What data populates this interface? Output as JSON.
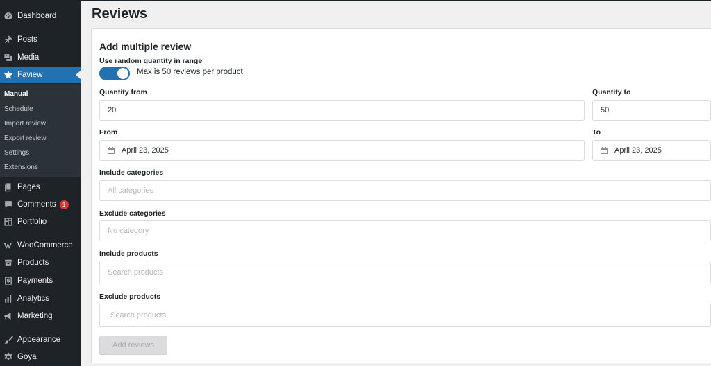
{
  "sidebar": {
    "items": [
      {
        "label": "Dashboard",
        "icon": "dashboard-icon"
      },
      {
        "label": "Posts",
        "icon": "pin-icon"
      },
      {
        "label": "Media",
        "icon": "media-icon"
      },
      {
        "label": "Faview",
        "icon": "star-icon"
      },
      {
        "label": "Pages",
        "icon": "pages-icon"
      },
      {
        "label": "Comments",
        "icon": "comment-icon",
        "badge": "1"
      },
      {
        "label": "Portfolio",
        "icon": "portfolio-icon"
      },
      {
        "label": "WooCommerce",
        "icon": "woocommerce-icon"
      },
      {
        "label": "Products",
        "icon": "products-icon"
      },
      {
        "label": "Payments",
        "icon": "payments-icon"
      },
      {
        "label": "Analytics",
        "icon": "analytics-icon"
      },
      {
        "label": "Marketing",
        "icon": "megaphone-icon"
      },
      {
        "label": "Appearance",
        "icon": "brush-icon"
      },
      {
        "label": "Goya",
        "icon": "gear-icon"
      }
    ],
    "submenu": [
      "Manual",
      "Schedule",
      "Import review",
      "Export review",
      "Settings",
      "Extensions"
    ]
  },
  "page": {
    "title": "Reviews"
  },
  "form": {
    "heading": "Add multiple review",
    "random_label": "Use random quantity in range",
    "toggle_text": "Max is 50 reviews per product",
    "qty_from_label": "Quantity from",
    "qty_from_value": "20",
    "qty_to_label": "Quantity to",
    "qty_to_value": "50",
    "from_label": "From",
    "from_value": "April 23, 2025",
    "to_label": "To",
    "to_value": "April 23, 2025",
    "include_cat_label": "Include categories",
    "include_cat_placeholder": "All categories",
    "exclude_cat_label": "Exclude categories",
    "exclude_cat_placeholder": "No category",
    "include_prod_label": "Include products",
    "include_prod_placeholder": "Search products",
    "exclude_prod_label": "Exclude products",
    "exclude_prod_placeholder": "Search products",
    "submit_label": "Add reviews"
  },
  "colors": {
    "accent": "#2271b1",
    "sidebar": "#1d2327",
    "badge": "#d63638"
  }
}
